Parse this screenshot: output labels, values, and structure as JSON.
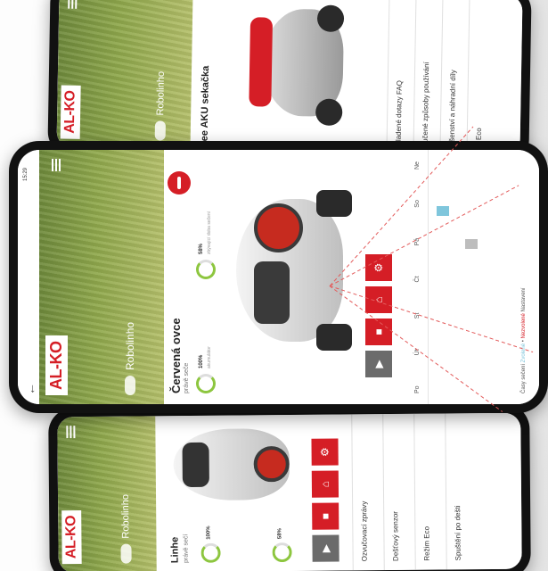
{
  "brand": {
    "logo": "AL-KO",
    "accent": "#d51e26",
    "green": "#8dc63f"
  },
  "front_phone": {
    "status_time": "15:29",
    "hero_title": "Robolinho",
    "robot_name": "Červená ovce",
    "robot_sub": "právě seče",
    "stat1_value": "100%",
    "stat1_label": "akumulátor",
    "stat2_value": "58%",
    "stat2_label": "zbývající doba sečení",
    "buttons": [
      "play-icon",
      "stop-icon",
      "home-icon",
      "home-icon",
      "gear-icon"
    ],
    "days": [
      "Po",
      "Út",
      "St",
      "Čt",
      "Pá",
      "So",
      "Ne"
    ],
    "legend": {
      "prefix": "Časy sečení",
      "blue": "Zvolené",
      "sep": "•",
      "red": "Nezvolené",
      "tail": "Nastavení"
    },
    "chart_data": {
      "type": "bar",
      "categories": [
        "Po",
        "Út",
        "St",
        "Čt",
        "Pá",
        "So",
        "Ne"
      ],
      "series": [
        {
          "values": [
            0,
            0,
            0,
            0,
            0,
            1,
            0
          ],
          "color": "#7fc6dc"
        },
        {
          "values": [
            0,
            0,
            0,
            0,
            1,
            0,
            0
          ],
          "color": "#bdbdbd"
        }
      ]
    }
  },
  "back_top_phone": {
    "hero_title": "Robolinho",
    "headline": "ee AKU sekačka",
    "menu": [
      "kladené dotazy FAQ",
      "ručené způsoby používání",
      "ušenství a náhradní díly",
      "n Eco"
    ]
  },
  "back_bottom_phone": {
    "hero_title": "Robolinho",
    "robot_name": "Linhe",
    "robot_sub": "právě sečí",
    "stat1_value": "100%",
    "stat2_value": "58%",
    "menu": [
      "Ozvučovací zprávy",
      "Dešťový senzor",
      "Režim Eco",
      "Spuštění po dešti"
    ]
  }
}
